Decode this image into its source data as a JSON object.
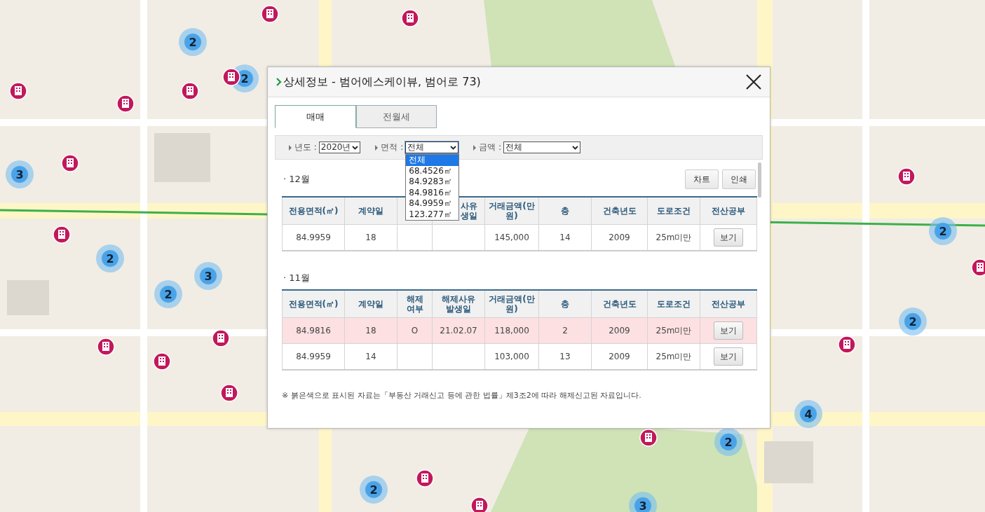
{
  "map": {
    "clusters": [
      {
        "count": "2"
      },
      {
        "count": "2"
      },
      {
        "count": "3"
      },
      {
        "count": "2"
      },
      {
        "count": "3"
      },
      {
        "count": "2"
      },
      {
        "count": "2"
      },
      {
        "count": "2"
      },
      {
        "count": "4"
      },
      {
        "count": "2"
      },
      {
        "count": "2"
      },
      {
        "count": "3"
      }
    ]
  },
  "dialog": {
    "title": "상세정보 - 범어에스케이뷰, 범어로 73)",
    "tabs": [
      {
        "label": "매매",
        "selected": true
      },
      {
        "label": "전월세",
        "selected": false
      }
    ],
    "filters": [
      {
        "label": "년도 :",
        "value": "2020년",
        "expanded": false
      },
      {
        "label": "면적 :",
        "value": "전체",
        "expanded": true,
        "options": [
          {
            "label": "전체",
            "selected": true
          },
          {
            "label": "68.4526㎡",
            "selected": false
          },
          {
            "label": "84.9283㎡",
            "selected": false
          },
          {
            "label": "84.9816㎡",
            "selected": false
          },
          {
            "label": "84.9959㎡",
            "selected": false
          },
          {
            "label": "123.277㎡",
            "selected": false
          }
        ]
      },
      {
        "label": "금액 :",
        "value": "전체",
        "expanded": false
      }
    ],
    "buttons": [
      "차트",
      "인쇄"
    ],
    "months": [
      {
        "title": "· 12월",
        "columns": [
          {
            "label": "전용면적(㎡)"
          },
          {
            "label": "계약일"
          },
          {},
          {
            "label": "사유\n생일"
          },
          {
            "label": "거래금액(만\n원)"
          },
          {
            "label": "층"
          },
          {
            "label": "건축년도"
          },
          {
            "label": "도로조건"
          },
          {
            "label": "전산공부"
          }
        ],
        "rows": [
          {
            "cancelled": false,
            "cells": [
              "84.9959",
              "18",
              "",
              "",
              "145,000",
              "14",
              "2009",
              "25m미만"
            ],
            "action": "보기"
          }
        ]
      },
      {
        "title": "· 11월",
        "columns": [
          {
            "label": "전용면적(㎡)"
          },
          {
            "label": "계약일"
          },
          {
            "label": "해제\n여부"
          },
          {
            "label": "해제사유\n발생일"
          },
          {
            "label": "거래금액(만\n원)"
          },
          {
            "label": "층"
          },
          {
            "label": "건축년도"
          },
          {
            "label": "도로조건"
          },
          {
            "label": "전산공부"
          }
        ],
        "rows": [
          {
            "cancelled": true,
            "cells": [
              "84.9816",
              "18",
              "O",
              "21.02.07",
              "118,000",
              "2",
              "2009",
              "25m미만"
            ],
            "action": "보기"
          },
          {
            "cancelled": false,
            "cells": [
              "84.9959",
              "14",
              "",
              "",
              "103,000",
              "13",
              "2009",
              "25m미만"
            ],
            "action": "보기"
          }
        ]
      }
    ],
    "note": "※ 붉은색으로 표시된 자료는「부동산 거래신고 등에 관한 법률」제3조2에 따라 해제신고된 자료입니다."
  }
}
